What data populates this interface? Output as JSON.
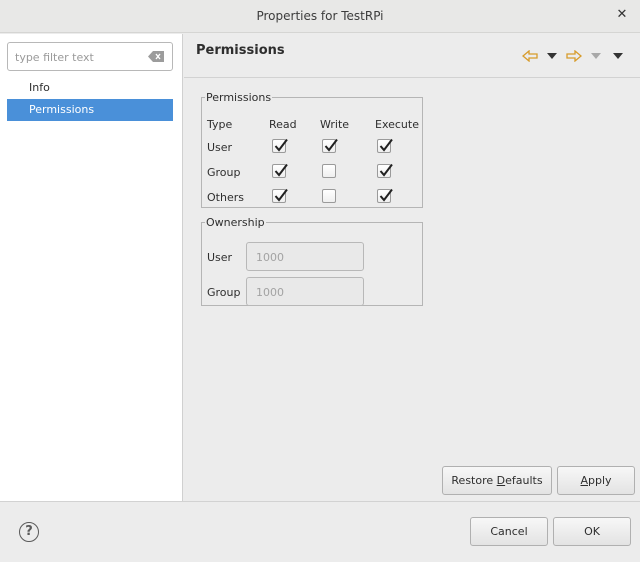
{
  "window": {
    "title": "Properties for TestRPi"
  },
  "sidebar": {
    "filter_placeholder": "type filter text",
    "items": [
      {
        "label": "Info",
        "selected": false
      },
      {
        "label": "Permissions",
        "selected": true
      }
    ]
  },
  "page": {
    "title": "Permissions"
  },
  "permissions": {
    "legend": "Permissions",
    "headers": [
      "Type",
      "Read",
      "Write",
      "Execute"
    ],
    "rows": [
      {
        "type": "User",
        "read": true,
        "write": true,
        "execute": true
      },
      {
        "type": "Group",
        "read": true,
        "write": false,
        "execute": true
      },
      {
        "type": "Others",
        "read": true,
        "write": false,
        "execute": true
      }
    ]
  },
  "ownership": {
    "legend": "Ownership",
    "user_label": "User",
    "user_value": "1000",
    "group_label": "Group",
    "group_value": "1000"
  },
  "buttons": {
    "restore_defaults_pre": "Restore ",
    "restore_defaults_mnemonic": "D",
    "restore_defaults_post": "efaults",
    "apply_mnemonic": "A",
    "apply_post": "pply",
    "cancel": "Cancel",
    "ok": "OK"
  },
  "colors": {
    "selection": "#4a90d9",
    "nav_arrow": "#e0a030"
  },
  "icons": {
    "back": "arrow-left-icon",
    "forward": "arrow-right-icon",
    "help": "help-icon",
    "clear": "clear-filter-icon",
    "close": "close-icon"
  }
}
